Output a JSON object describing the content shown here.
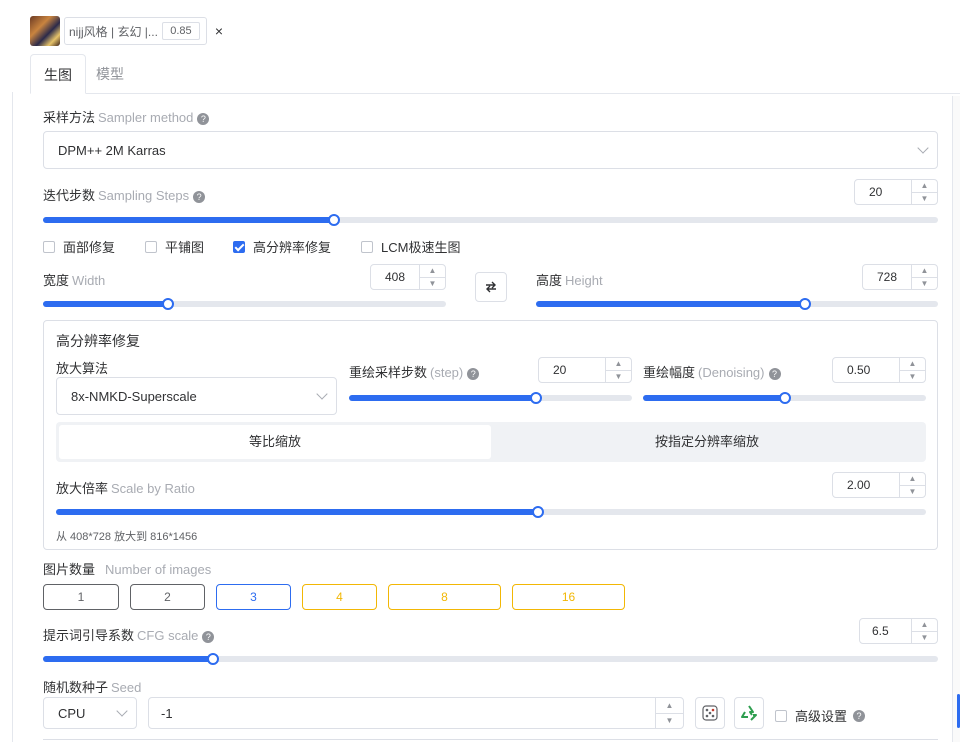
{
  "lora": {
    "name": "nijj风格 | 玄幻 |...",
    "weight": "0.85",
    "close": "×"
  },
  "tabs": [
    {
      "label": "生图"
    },
    {
      "label": "模型"
    }
  ],
  "sampler": {
    "label": "采样方法",
    "sub": "Sampler method",
    "value": "DPM++ 2M Karras"
  },
  "steps": {
    "label": "迭代步数",
    "sub": "Sampling Steps",
    "value": "20",
    "percent": 32.5
  },
  "options": [
    {
      "label": "面部修复",
      "checked": false
    },
    {
      "label": "平铺图",
      "checked": false
    },
    {
      "label": "高分辨率修复",
      "checked": true
    },
    {
      "label": "LCM极速生图",
      "checked": false
    }
  ],
  "width": {
    "label": "宽度",
    "sub": "Width",
    "value": "408",
    "percent": 31
  },
  "height": {
    "label": "高度",
    "sub": "Height",
    "value": "728",
    "percent": 67
  },
  "hires": {
    "title": "高分辨率修复",
    "upscaler_label": "放大算法",
    "upscaler_value": "8x-NMKD-Superscale",
    "steps_label": "重绘采样步数",
    "steps_sub": "(step)",
    "steps_value": "20",
    "steps_percent": 66,
    "denoise_label": "重绘幅度",
    "denoise_sub": "(Denoising)",
    "denoise_value": "0.50",
    "denoise_percent": 50,
    "mode_a": "等比缩放",
    "mode_b": "按指定分辨率缩放",
    "scale_label": "放大倍率",
    "scale_sub": "Scale by Ratio",
    "scale_value": "2.00",
    "scale_percent": 55.4,
    "hint": "从 408*728 放大到 816*1456"
  },
  "images": {
    "label": "图片数量",
    "sub": "Number of images",
    "counts": [
      "1",
      "2",
      "3",
      "4",
      "8",
      "16"
    ],
    "selected": "3"
  },
  "cfg": {
    "label": "提示词引导系数",
    "sub": "CFG scale",
    "value": "6.5",
    "percent": 19
  },
  "seed": {
    "label": "随机数种子",
    "sub": "Seed",
    "device": "CPU",
    "value": "-1",
    "advanced": "高级设置"
  },
  "colors": {
    "accent": "#2d6cf0",
    "gold": "#f2b705",
    "border": "#dcdfe6"
  }
}
